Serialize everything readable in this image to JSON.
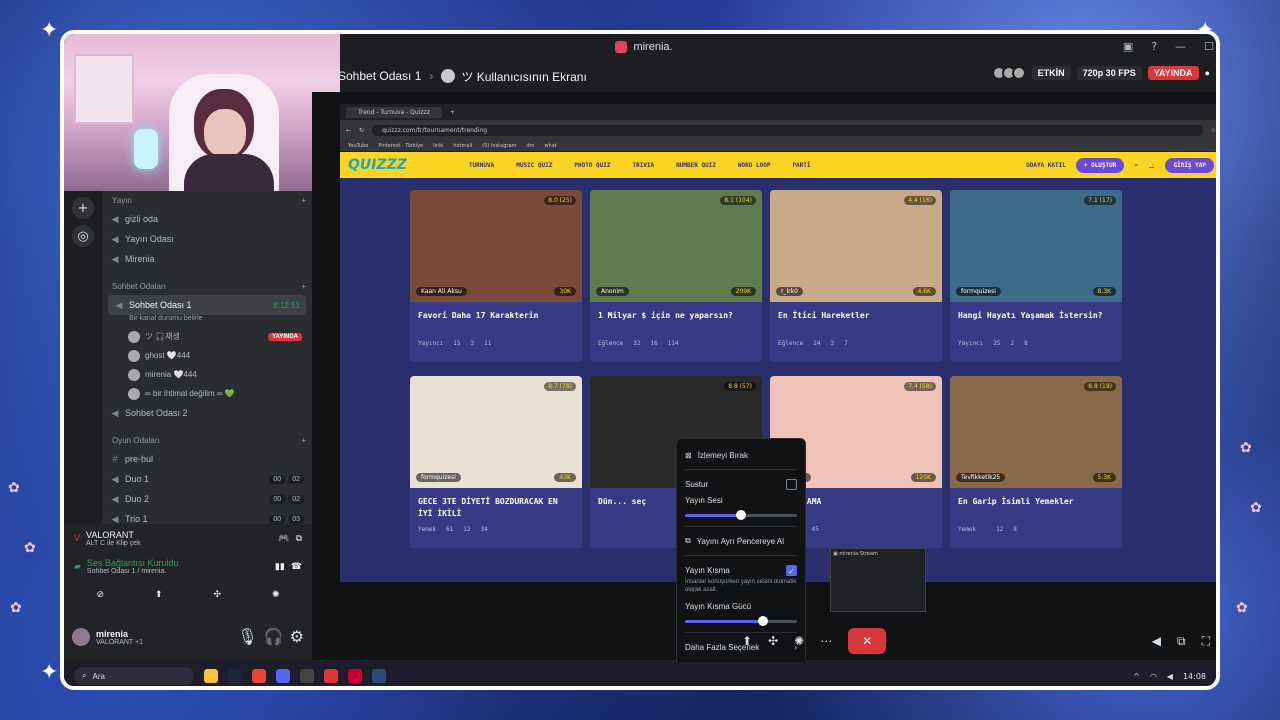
{
  "window": {
    "title": "mirenia."
  },
  "call": {
    "channel": "Sohbet Odası 1",
    "screen_owner": "ツ Kullanıcısının Ekranı",
    "activity_label": "ETKİN",
    "quality": "720p 30 FPS",
    "live": "YAYINDA"
  },
  "sidebar": {
    "cat_stream": "Yayın",
    "stream_channels": [
      "gizli oda",
      "Yayın Odası",
      "Mirenia"
    ],
    "cat_chat": "Sohbet Odaları",
    "active_channel": "Sohbet Odası 1",
    "timer": "8:12:51",
    "status": "Bir kanal durumu belirle",
    "users": [
      {
        "name": "ツ 🎧재생",
        "badge": "YAYINDA"
      },
      {
        "name": "ghost 🤍444"
      },
      {
        "name": "mirenia 🤍444"
      },
      {
        "name": "∞ bir ihtimal değilim ∞ 💚"
      }
    ],
    "channel2": "Sohbet Odası 2",
    "cat_game": "Oyun Odaları",
    "game_channels": [
      {
        "name": "pre-bul",
        "counts": []
      },
      {
        "name": "Duo 1",
        "counts": [
          "00",
          "02"
        ]
      },
      {
        "name": "Duo 2",
        "counts": [
          "00",
          "02"
        ]
      },
      {
        "name": "Trio 1",
        "counts": [
          "00",
          "03"
        ]
      }
    ]
  },
  "activity": {
    "game": "VALORANT",
    "clip_hint": "ALT C ile Klip çek",
    "voice": "Ses Bağlantısı Kuruldu",
    "voice_sub": "Sohbet Odası 1 / mirenia."
  },
  "user": {
    "name": "mirenia",
    "sub": "VALORANT +1"
  },
  "browser": {
    "tab": "Trend - Turnuva - Quizzz",
    "url": "quizzz.com/tr/tournament/trending",
    "bookmarks": [
      "YouTube",
      "Pinterest · Türkiye",
      "linki",
      "hotmail",
      "(0) Instagram",
      "dm",
      "what"
    ],
    "nav": [
      "TURNUVA",
      "MUSIC QUIZ",
      "PHOTO QUIZ",
      "TRIVIA",
      "NUMBER QUIZ",
      "WORD LOOP",
      "PARTİ"
    ],
    "join": "ODAYA KATIL",
    "create": "+ OLUŞTUR",
    "login": "GİRİŞ YAP",
    "logo": "QUIZZZ"
  },
  "cards": [
    {
      "title": "Favori Daha 17 Karakterin",
      "author": "Kaan Ali Aksu",
      "plays": "30K",
      "rating": "8.0 (25)",
      "cat": "Yayıncı",
      "a": "15",
      "b": "3",
      "c": "11",
      "color": "#7a4a3a"
    },
    {
      "title": "1 Milyar $ için ne yaparsın?",
      "author": "Anonim",
      "plays": "209K",
      "rating": "8.1 (104)",
      "cat": "Eğlence",
      "a": "32",
      "b": "16",
      "c": "114",
      "color": "#5e7c4e"
    },
    {
      "title": "En İtici Hareketler",
      "author": "r_lrk0",
      "plays": "4.6K",
      "rating": "4.4 (16)",
      "cat": "Eğlence",
      "a": "24",
      "b": "3",
      "c": "7",
      "color": "#c9a98a"
    },
    {
      "title": "Hangi Hayatı Yaşamak İstersin?",
      "author": "formquizesi",
      "plays": "8.3K",
      "rating": "7.1 (17)",
      "cat": "Yayıncı",
      "a": "25",
      "b": "2",
      "c": "8",
      "color": "#3d6b8a"
    },
    {
      "title": "GECE 3TE DİYETİ BOZDURACAK EN İYİ İKİLİ",
      "author": "formquizesi",
      "plays": "43K",
      "rating": "8.7 (78)",
      "cat": "Yemek",
      "a": "61",
      "b": "12",
      "c": "34",
      "color": "#e8e0d0"
    },
    {
      "title": "Dün... seç",
      "author": "",
      "plays": "",
      "rating": "8.8 (57)",
      "cat": "",
      "a": "",
      "b": "",
      "c": "",
      "color": "#2a2a2a"
    },
    {
      "title": "10/10 AMA",
      "author": "Busenur",
      "plays": "120K",
      "rating": "7.4 (58)",
      "cat": "",
      "a": "",
      "b": "6",
      "c": "45",
      "color": "#f0c3b8"
    },
    {
      "title": "En Garip İsimli Yemekler",
      "author": "Tevfikketik25",
      "plays": "5.3K",
      "rating": "8.8 (19)",
      "cat": "Yemek",
      "a": "",
      "b": "12",
      "c": "8",
      "color": "#8a6a4a"
    }
  ],
  "popup": {
    "stop": "İzlemeyi Bırak",
    "mute": "Sustur",
    "stream_volume": "Yayın Sesi",
    "stream_volume_value": 0.5,
    "popout": "Yayını Ayrı Pencereye Al",
    "attenuation": "Yayın Kısma",
    "attenuation_desc": "İnsanlar konuşurken yayın sesini otomatik olarak azalt.",
    "attenuation_strength": "Yayın Kısma Gücü",
    "attenuation_value": 0.7,
    "more": "Daha Fazla Seçenek"
  },
  "taskbar": {
    "search": "Ara",
    "clock": "14:08"
  },
  "colors": {
    "accent": "#5865f2",
    "live": "#da373c",
    "quiz_yellow": "#f9d422"
  }
}
